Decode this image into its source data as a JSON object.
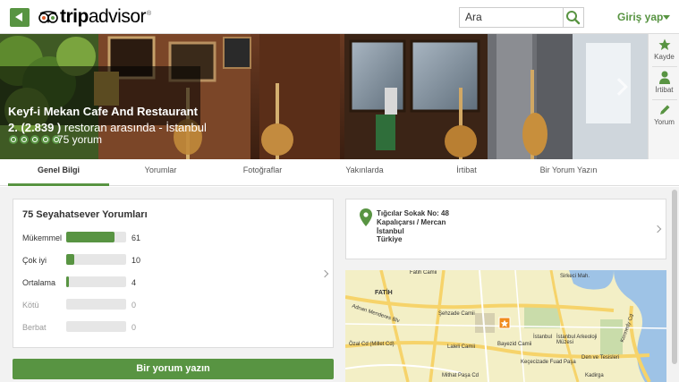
{
  "header": {
    "logo_text_bold": "trip",
    "logo_text_rest": "advisor",
    "logo_tm": "®",
    "search_placeholder": "Ara",
    "login_label": "Giriş yap"
  },
  "hero": {
    "restaurant_name": "Keyf-i Mekan Cafe And Restaurant",
    "rank_prefix": "2. (2.839 )",
    "rank_suffix": " restoran arasında - İstanbul",
    "rating_bubbles": 5,
    "review_count": "75 yorum"
  },
  "side_panel": {
    "items": [
      {
        "icon": "star-icon",
        "label": "Kayde"
      },
      {
        "icon": "person-icon",
        "label": "İrtibat"
      },
      {
        "icon": "pencil-icon",
        "label": "Yorum"
      }
    ]
  },
  "tabs": [
    {
      "label": "Genel Bilgi",
      "active": true
    },
    {
      "label": "Yorumlar"
    },
    {
      "label": "Fotoğraflar"
    },
    {
      "label": "Yakınlarda"
    },
    {
      "label": "İrtibat"
    },
    {
      "label": "Bir Yorum Yazın"
    }
  ],
  "reviews": {
    "title": "75 Seyahatsever Yorumları",
    "rows": [
      {
        "label": "Mükemmel",
        "count": "61",
        "fraction": 0.81
      },
      {
        "label": "Çok iyi",
        "count": "10",
        "fraction": 0.13
      },
      {
        "label": "Ortalama",
        "count": "4",
        "fraction": 0.05
      },
      {
        "label": "Kötü",
        "count": "0",
        "fraction": 0
      },
      {
        "label": "Berbat",
        "count": "0",
        "fraction": 0
      }
    ]
  },
  "write_review_button": "Bir yorum yazın",
  "address": {
    "lines": [
      "Tığcılar Sokak No: 48",
      "Kapalıçarsı / Mercan",
      "İstanbul",
      "Türkiye"
    ]
  },
  "map_labels": {
    "fatih_camii": "Fatih Camii",
    "fatih": "FATİH",
    "sehzade_camii": "Şehzade Camii",
    "laleli_camii": "Laleli Camii",
    "bayezid_camii": "Bayezid Camii",
    "istanbul_arkeoloji": "İstanbul Arkeoloji Müzesi",
    "kececizade": "Keçecizade Fuad Paşa",
    "istanbul": "İstanbul",
    "den_ve_tesisleri": "Den ve Tesisleri",
    "sirkeci": "Sirkeci Mah.",
    "kennedy": "Kennedy Cd",
    "kadirga": "Kadirga",
    "adnan_menderes": "Adnan Menderes Blv",
    "ozal_cd": "Özal Cd (Millet Cd)",
    "mithat_pasa": "Mithat Paşa Cd"
  },
  "colors": {
    "brand_green": "#589442"
  }
}
